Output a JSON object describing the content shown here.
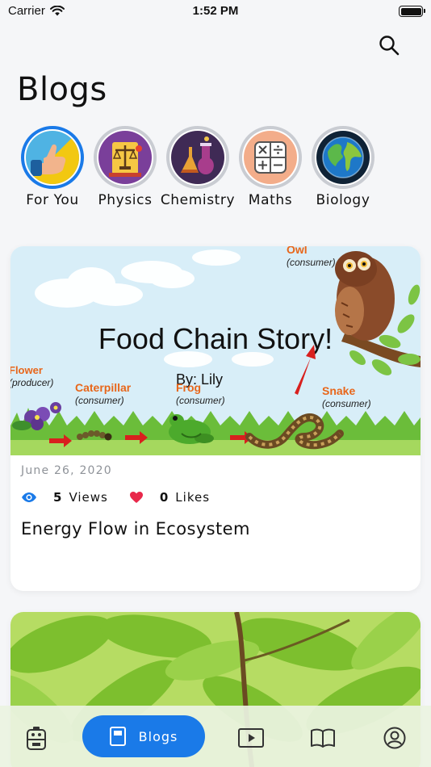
{
  "status_bar": {
    "carrier": "Carrier",
    "time": "1:52 PM"
  },
  "header": {
    "title": "Blogs"
  },
  "categories": [
    {
      "label": "For You",
      "active": true
    },
    {
      "label": "Physics",
      "active": false
    },
    {
      "label": "Chemistry",
      "active": false
    },
    {
      "label": "Maths",
      "active": false
    },
    {
      "label": "Biology",
      "active": false
    }
  ],
  "posts": [
    {
      "image": {
        "title": "Food Chain Story!",
        "byline": "By: Lily",
        "labels": {
          "owl": "Owl",
          "owl_role": "(consumer)",
          "flower": "Flower",
          "flower_role": "(producer)",
          "caterpillar": "Caterpillar",
          "caterpillar_role": "(consumer)",
          "frog": "Frog",
          "frog_role": "(consumer)",
          "snake": "Snake",
          "snake_role": "(consumer)"
        }
      },
      "date": "June 26, 2020",
      "views_count": "5",
      "views_label": "Views",
      "likes_count": "0",
      "likes_label": "Likes",
      "title": "Energy Flow in Ecosystem"
    }
  ],
  "tab_bar": {
    "active_label": "Blogs"
  },
  "colors": {
    "accent": "#1a7ae8",
    "like": "#e8284a",
    "label_orange": "#e8661a"
  }
}
